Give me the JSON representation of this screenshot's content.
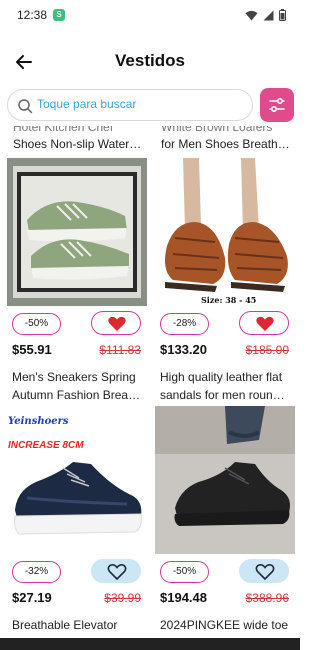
{
  "status": {
    "time": "12:38",
    "app_icon_letter": "S"
  },
  "header": {
    "title": "Vestidos"
  },
  "search": {
    "placeholder": "Toque para buscar"
  },
  "peek": {
    "left_line1": "Hotel Kitchen Chef",
    "left_line2": "Shoes Non-slip Water…",
    "right_line1": "White Brown Loafers",
    "right_line2": "for Men Shoes Breath…"
  },
  "products": [
    {
      "discount": "-50%",
      "price": "$55.91",
      "old_price": "$111.83",
      "title1": "Men's Sneakers Spring",
      "title2": "Autumn Fashion Brea…",
      "favorite": true
    },
    {
      "discount": "-28%",
      "price": "$133.20",
      "old_price": "$185.00",
      "title1": "High quality leather flat",
      "title2": "sandals for men roun…",
      "favorite": true,
      "image_caption": "Size: 38 - 45"
    },
    {
      "discount": "-32%",
      "price": "$27.19",
      "old_price": "$39.99",
      "title1": "Breathable Elevator",
      "title2": "",
      "favorite": false,
      "image_brand": "Yeinshoers",
      "image_caption": "INCREASE 8CM"
    },
    {
      "discount": "-50%",
      "price": "$194.48",
      "old_price": "$388.96",
      "title1": "2024PINGKEE wide toe",
      "title2": "",
      "favorite": false
    }
  ],
  "colors": {
    "accent": "#d2399b",
    "filter_bg": "#e04b8c",
    "link": "#36a5d8",
    "old_price": "#d4343d",
    "heart_red": "#e0262f",
    "heart_soft_bg": "#cbe6f5"
  }
}
